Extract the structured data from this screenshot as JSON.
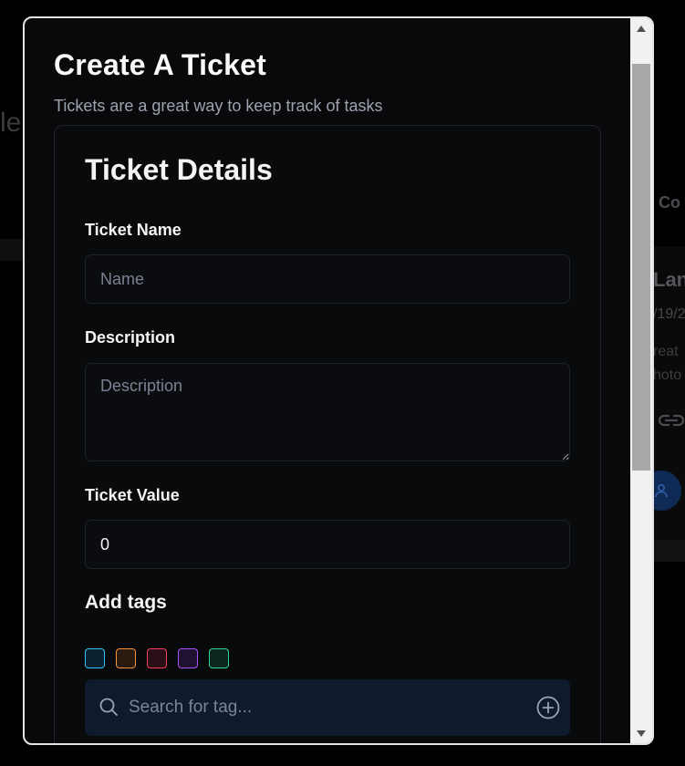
{
  "background": {
    "title_fragment": "le",
    "column_fragment": "Co",
    "card": {
      "title_fragment": "Lan",
      "date_fragment": "/19/2",
      "text_line1": "reat",
      "text_line2": "hoto"
    },
    "icons": [
      "link-icon",
      "user-icon"
    ]
  },
  "modal": {
    "title": "Create A Ticket",
    "subtitle": "Tickets are a great way to keep track of tasks",
    "card_title": "Ticket Details",
    "fields": {
      "name": {
        "label": "Ticket Name",
        "placeholder": "Name",
        "value": ""
      },
      "description": {
        "label": "Description",
        "placeholder": "Description",
        "value": ""
      },
      "value": {
        "label": "Ticket Value",
        "placeholder": "",
        "value": "0"
      }
    },
    "tags": {
      "heading": "Add tags",
      "swatch_colors": [
        "#38bdf8",
        "#fb923c",
        "#f43f5e",
        "#a855f7",
        "#34d399"
      ],
      "search_placeholder": "Search for tag...",
      "icons": [
        "search-icon",
        "plus-circle-icon"
      ]
    }
  },
  "scrollbar": {
    "icons": [
      "arrow-up-icon",
      "arrow-down-icon"
    ]
  }
}
